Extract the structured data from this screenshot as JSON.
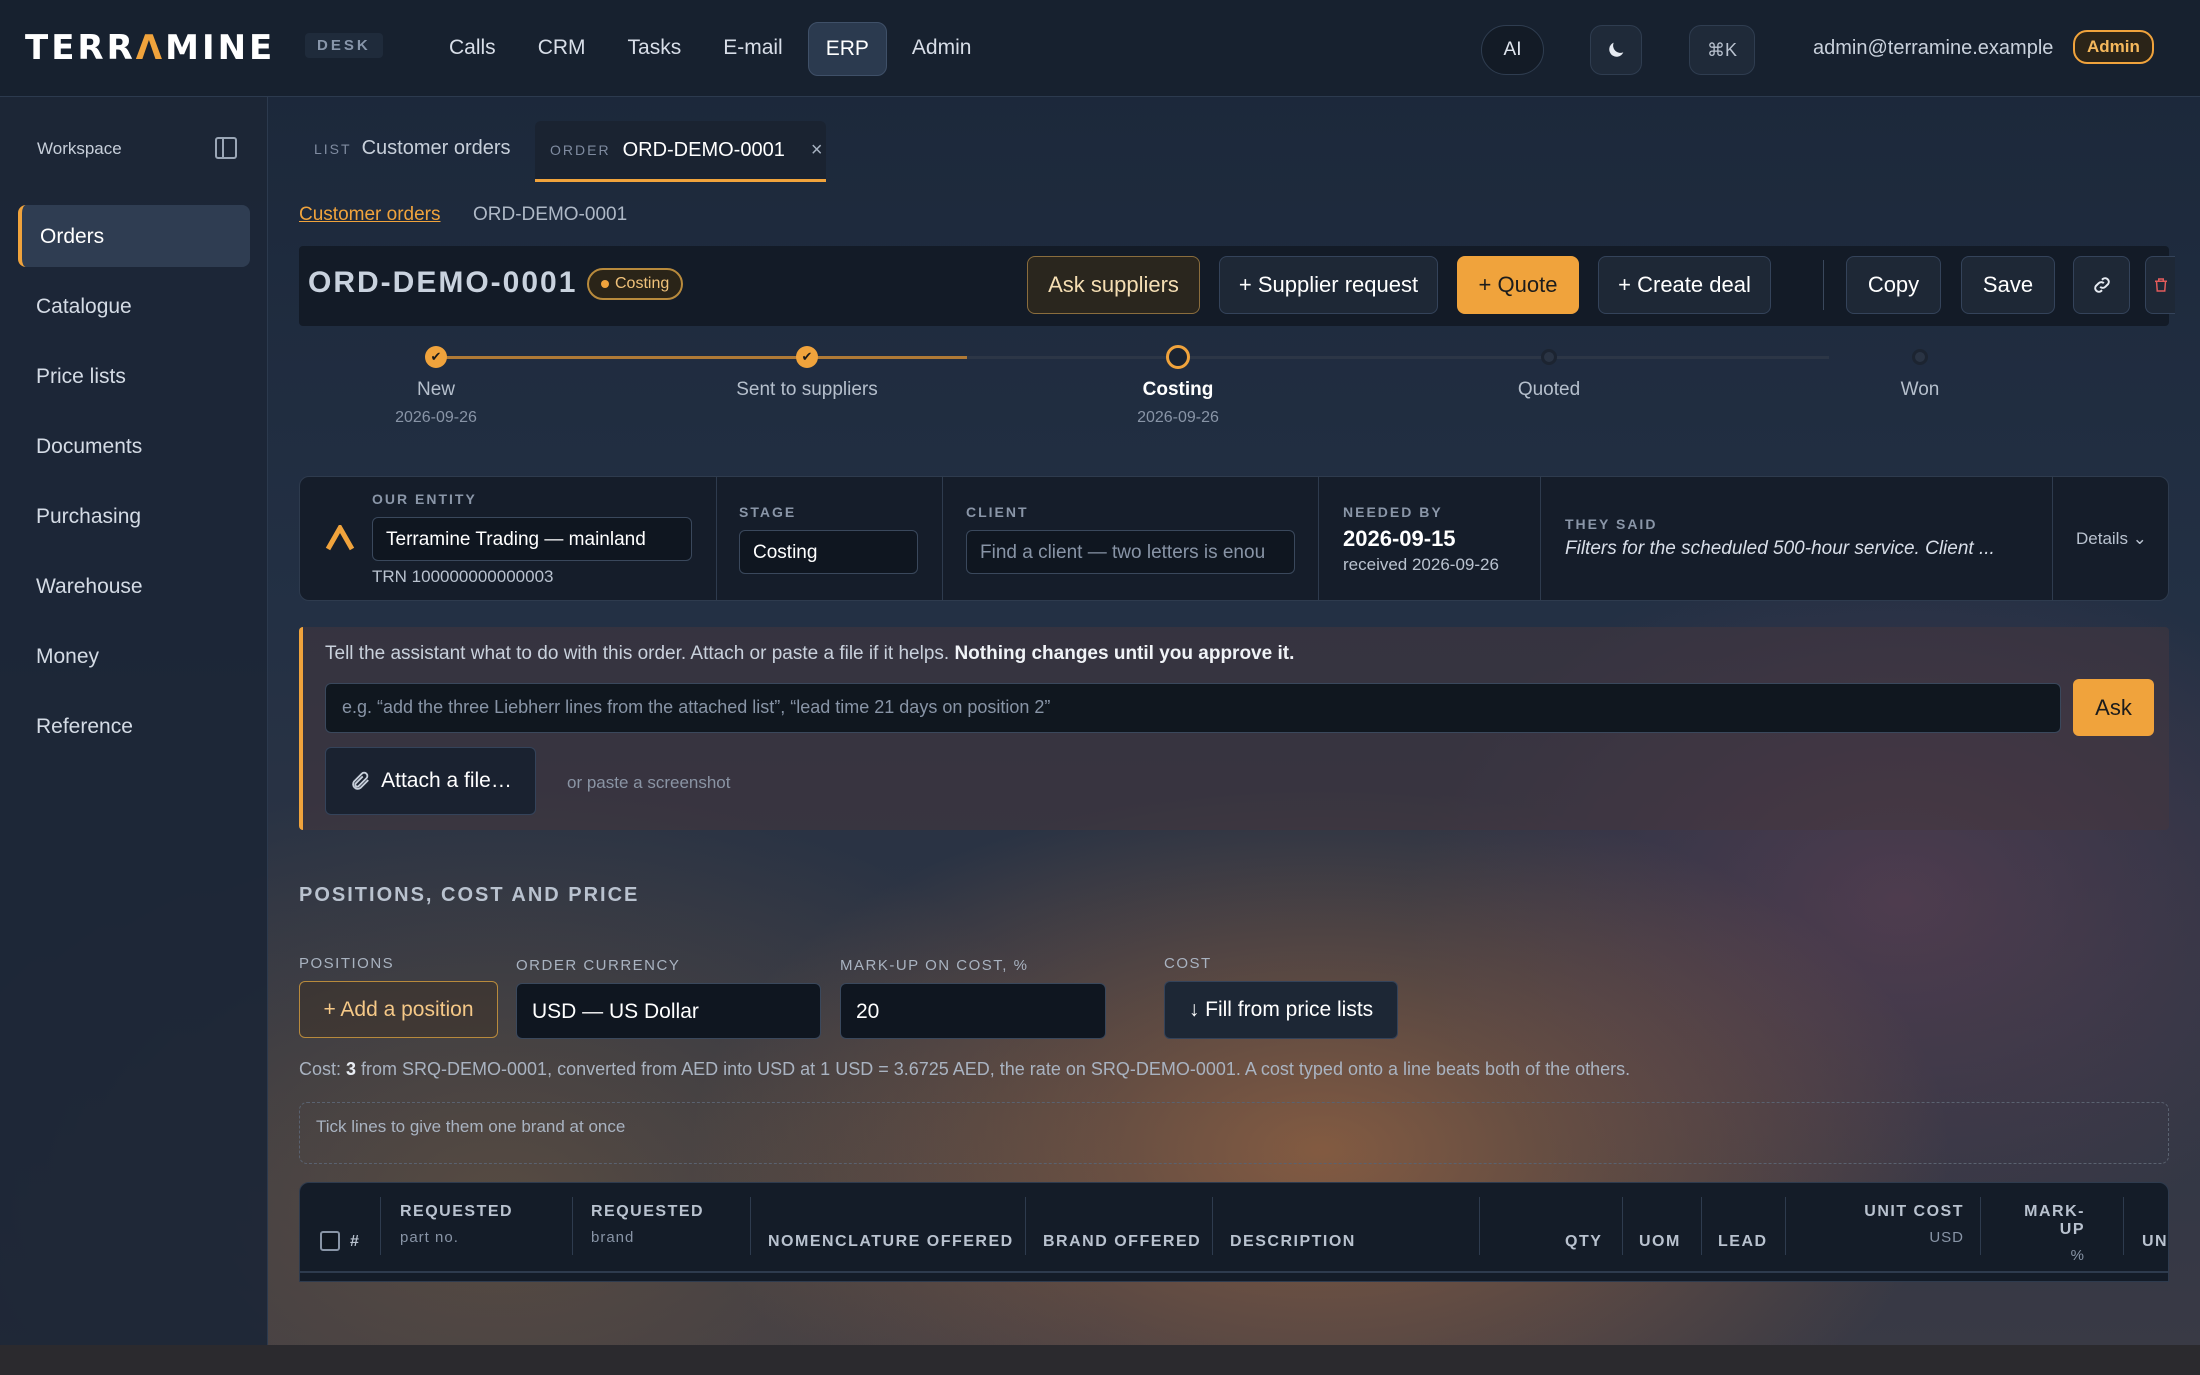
{
  "app": {
    "logo_pre": "TERR",
    "logo_mark": "Λ",
    "logo_post": "MINE",
    "badge": "DESK"
  },
  "nav": [
    {
      "label": "Calls"
    },
    {
      "label": "CRM"
    },
    {
      "label": "Tasks"
    },
    {
      "label": "E-mail"
    },
    {
      "label": "ERP",
      "active": true
    },
    {
      "label": "Admin"
    }
  ],
  "top": {
    "ai": "AI",
    "cmd": "⌘K",
    "user": "admin@terramine.example",
    "role": "Admin"
  },
  "sidebar": {
    "title": "Workspace",
    "items": [
      {
        "label": "Orders",
        "active": true
      },
      {
        "label": "Catalogue"
      },
      {
        "label": "Price lists"
      },
      {
        "label": "Documents"
      },
      {
        "label": "Purchasing"
      },
      {
        "label": "Warehouse"
      },
      {
        "label": "Money"
      },
      {
        "label": "Reference"
      }
    ]
  },
  "tabs": {
    "list_kind": "LIST",
    "list_label": "Customer orders",
    "order_kind": "ORDER",
    "order_label": "ORD-DEMO-0001",
    "close": "×"
  },
  "breadcrumb": {
    "parent": "Customer orders",
    "current": "ORD-DEMO-0001"
  },
  "header": {
    "title": "ORD-DEMO-0001",
    "status": "Costing",
    "ask": "Ask suppliers",
    "supplier_request": "+ Supplier request",
    "quote": "+ Quote",
    "create_deal": "+ Create deal",
    "copy": "Copy",
    "save": "Save"
  },
  "stages": [
    {
      "label": "New",
      "date": "2026-09-26",
      "state": "done"
    },
    {
      "label": "Sent to suppliers",
      "date": "",
      "state": "done"
    },
    {
      "label": "Costing",
      "date": "2026-09-26",
      "state": "current"
    },
    {
      "label": "Quoted",
      "date": "",
      "state": "todo"
    },
    {
      "label": "Won",
      "date": "",
      "state": "todo"
    }
  ],
  "info": {
    "entity_label": "OUR ENTITY",
    "entity_value": "Terramine Trading — mainland",
    "trn": "TRN 100000000000003",
    "stage_label": "STAGE",
    "stage_value": "Costing",
    "client_label": "CLIENT",
    "client_placeholder": "Find a client — two letters is enou",
    "needed_label": "NEEDED BY",
    "needed_value": "2026-09-15",
    "received": "received 2026-09-26",
    "said_label": "THEY SAID",
    "said_value": "Filters for the scheduled 500-hour service. Client ...",
    "details": "Details ⌄"
  },
  "assistant": {
    "msg": "Tell the assistant what to do with this order. Attach or paste a file if it helps.",
    "msg_bold": "Nothing changes until you approve it.",
    "placeholder": "e.g. “add the three Liebherr lines from the attached list”, “lead time 21 days on position 2”",
    "ask": "Ask",
    "attach": "Attach a file…",
    "paste": "or paste a screenshot"
  },
  "positions": {
    "section": "POSITIONS, COST AND PRICE",
    "positions_label": "POSITIONS",
    "add": "+ Add a position",
    "currency_label": "ORDER CURRENCY",
    "currency": "USD — US Dollar",
    "markup_label": "MARK-UP ON COST, %",
    "markup": "20",
    "cost_label": "COST",
    "fill": "↓ Fill from price lists",
    "note_pre": "Cost: ",
    "note_count": "3",
    "note_post": " from SRQ-DEMO-0001, converted from AED into USD at 1 USD = 3.6725 AED, the rate on SRQ-DEMO-0001. A cost typed onto a line beats both of the others.",
    "tick": "Tick lines to give them one brand at once"
  },
  "table": {
    "cols": [
      {
        "h": "#",
        "s": ""
      },
      {
        "h": "REQUESTED",
        "s": "part no."
      },
      {
        "h": "REQUESTED",
        "s": "brand"
      },
      {
        "h": "NOMENCLATURE OFFERED",
        "s": ""
      },
      {
        "h": "BRAND OFFERED",
        "s": ""
      },
      {
        "h": "DESCRIPTION",
        "s": ""
      },
      {
        "h": "QTY",
        "s": ""
      },
      {
        "h": "UOM",
        "s": ""
      },
      {
        "h": "LEAD",
        "s": ""
      },
      {
        "h": "UNIT COST",
        "s": "USD"
      },
      {
        "h": "MARK-UP",
        "s": "%"
      },
      {
        "h": "UN",
        "s": ""
      }
    ]
  },
  "colors": {
    "accent": "#f0a33c",
    "panel": "#151d2a",
    "topbar": "#17212f"
  }
}
